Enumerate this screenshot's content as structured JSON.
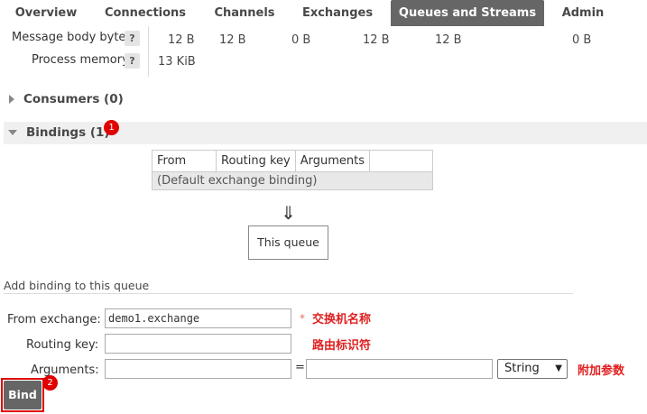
{
  "nav": {
    "tabs": [
      {
        "label": "Overview",
        "active": false
      },
      {
        "label": "Connections",
        "active": false
      },
      {
        "label": "Channels",
        "active": false
      },
      {
        "label": "Exchanges",
        "active": false
      },
      {
        "label": "Queues and Streams",
        "active": true
      },
      {
        "label": "Admin",
        "active": false
      }
    ],
    "active_color": "#666666"
  },
  "stats": {
    "message_body_bytes": {
      "label": "Message body bytes",
      "help": "?",
      "values": [
        "12 B",
        "12 B",
        "0 B",
        "12 B",
        "12 B",
        "0 B"
      ]
    },
    "process_memory": {
      "label": "Process memory",
      "help": "?",
      "value": "13 KiB"
    }
  },
  "consumers": {
    "label": "Consumers (0)",
    "expanded": false,
    "icon": "triangle-right-icon"
  },
  "bindings": {
    "label": "Bindings (1)",
    "expanded": true,
    "icon": "triangle-down-icon",
    "badge": "1",
    "table": {
      "headers": [
        "From",
        "Routing key",
        "Arguments",
        ""
      ],
      "rows": [
        [
          "(Default exchange binding)"
        ]
      ]
    },
    "arrow": "⇓",
    "queue_box": "This queue"
  },
  "add_binding": {
    "title": "Add binding to this queue",
    "from_exchange": {
      "label": "From exchange:",
      "value": "demo1.exchange",
      "required_mark": "*"
    },
    "routing_key": {
      "label": "Routing key:",
      "value": ""
    },
    "arguments": {
      "label": "Arguments:",
      "key": "",
      "equals": "=",
      "value": "",
      "type": "String",
      "type_options": [
        "String"
      ]
    },
    "bind_button": "Bind",
    "bind_badge": "2"
  },
  "annotations": {
    "exchange_name": "交换机名称",
    "routing_key": "路由标识符",
    "extra_args": "附加参数",
    "color": "#e02020"
  }
}
